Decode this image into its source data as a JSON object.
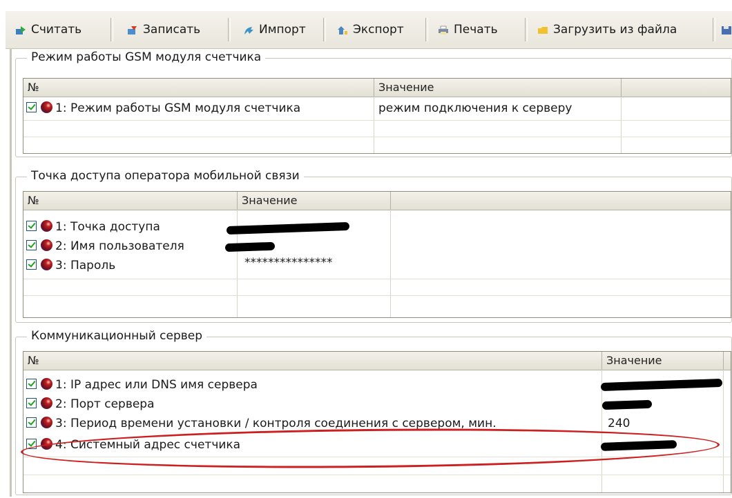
{
  "toolbar": {
    "read": "Считать",
    "write": "Записать",
    "import": "Импорт",
    "export": "Экспорт",
    "print": "Печать",
    "load_file": "Загрузить из файла"
  },
  "groups": {
    "gsm_mode": {
      "title": "Режим работы GSM модуля счетчика",
      "col_no": "№",
      "col_value": "Значение",
      "rows": [
        {
          "label": "1: Режим работы GSM модуля счетчика",
          "value": "режим подключения к серверу"
        }
      ]
    },
    "apn": {
      "title": "Точка доступа оператора мобильной связи",
      "col_no": "№",
      "col_value": "Значение",
      "rows": [
        {
          "label": "1: Точка доступа",
          "value": ""
        },
        {
          "label": "2: Имя пользователя",
          "value": ""
        },
        {
          "label": "3: Пароль",
          "value": "***************"
        }
      ]
    },
    "server": {
      "title": "Коммуникационный сервер",
      "col_no": "№",
      "col_value": "Значение",
      "rows": [
        {
          "label": "1: IP адрес или DNS имя сервера",
          "value": ""
        },
        {
          "label": "2: Порт сервера",
          "value": ""
        },
        {
          "label": "3: Период времени установки / контроля соединения с сервером, мин.",
          "value": "240"
        },
        {
          "label": "4: Системный адрес счетчика",
          "value": ""
        }
      ]
    }
  },
  "colors": {
    "highlight_oval": "#cc2020",
    "check": "#21a121"
  }
}
